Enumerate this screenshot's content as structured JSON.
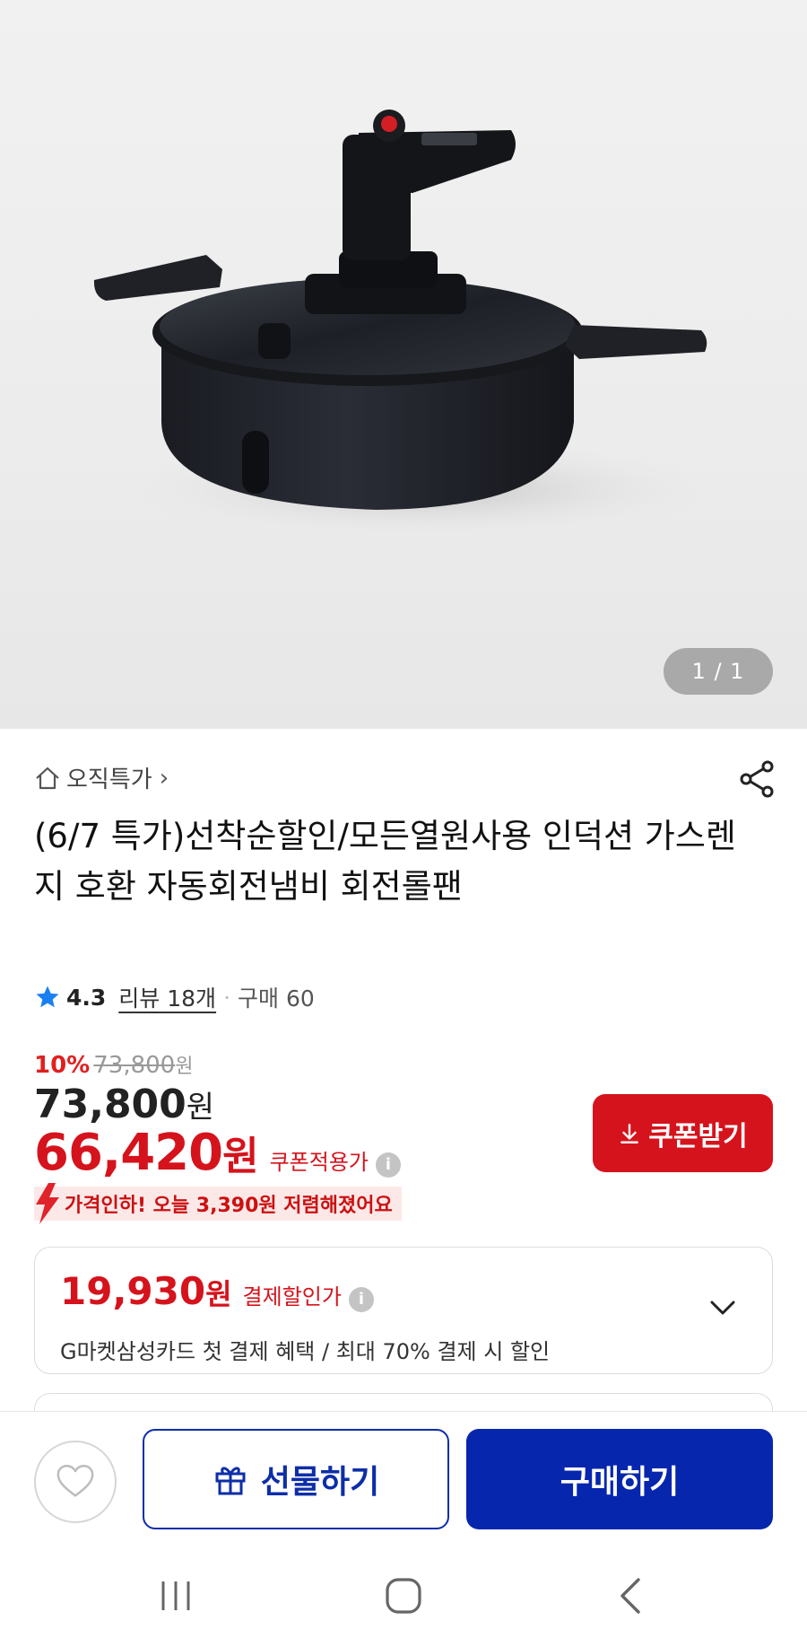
{
  "gallery": {
    "counter": "1 / 1",
    "image_alt": "자동회전냄비 회전롤팬 product image"
  },
  "category": {
    "label": "오직특가",
    "chevron": "›"
  },
  "product": {
    "title": "(6/7 특가)선착순할인/모든열원사용 인덕션 가스렌지 호환 자동회전냄비 회전롤팬",
    "rating": "4.3",
    "review_label": "리뷰 18개",
    "purchase_label": "구매 60"
  },
  "pricing": {
    "discount_rate": "10%",
    "original_price": "73,800",
    "original_unit": "원",
    "price": "73,800",
    "price_unit": "원",
    "coupon_price": "66,420",
    "coupon_unit": "원",
    "coupon_label": "쿠폰적용가",
    "coupon_button": "쿠폰받기",
    "drop_notice": "가격인하! 오늘 3,390원 저렴해졌어요"
  },
  "payment_card": {
    "price": "19,930",
    "unit": "원",
    "label": "결제할인가",
    "description": "G마켓삼성카드 첫 결제 혜택 / 최대 70% 결제 시 할인"
  },
  "bottom_bar": {
    "gift_label": "선물하기",
    "buy_label": "구매하기"
  },
  "colors": {
    "accent_red": "#d5131c",
    "brand_blue": "#0626ad"
  }
}
